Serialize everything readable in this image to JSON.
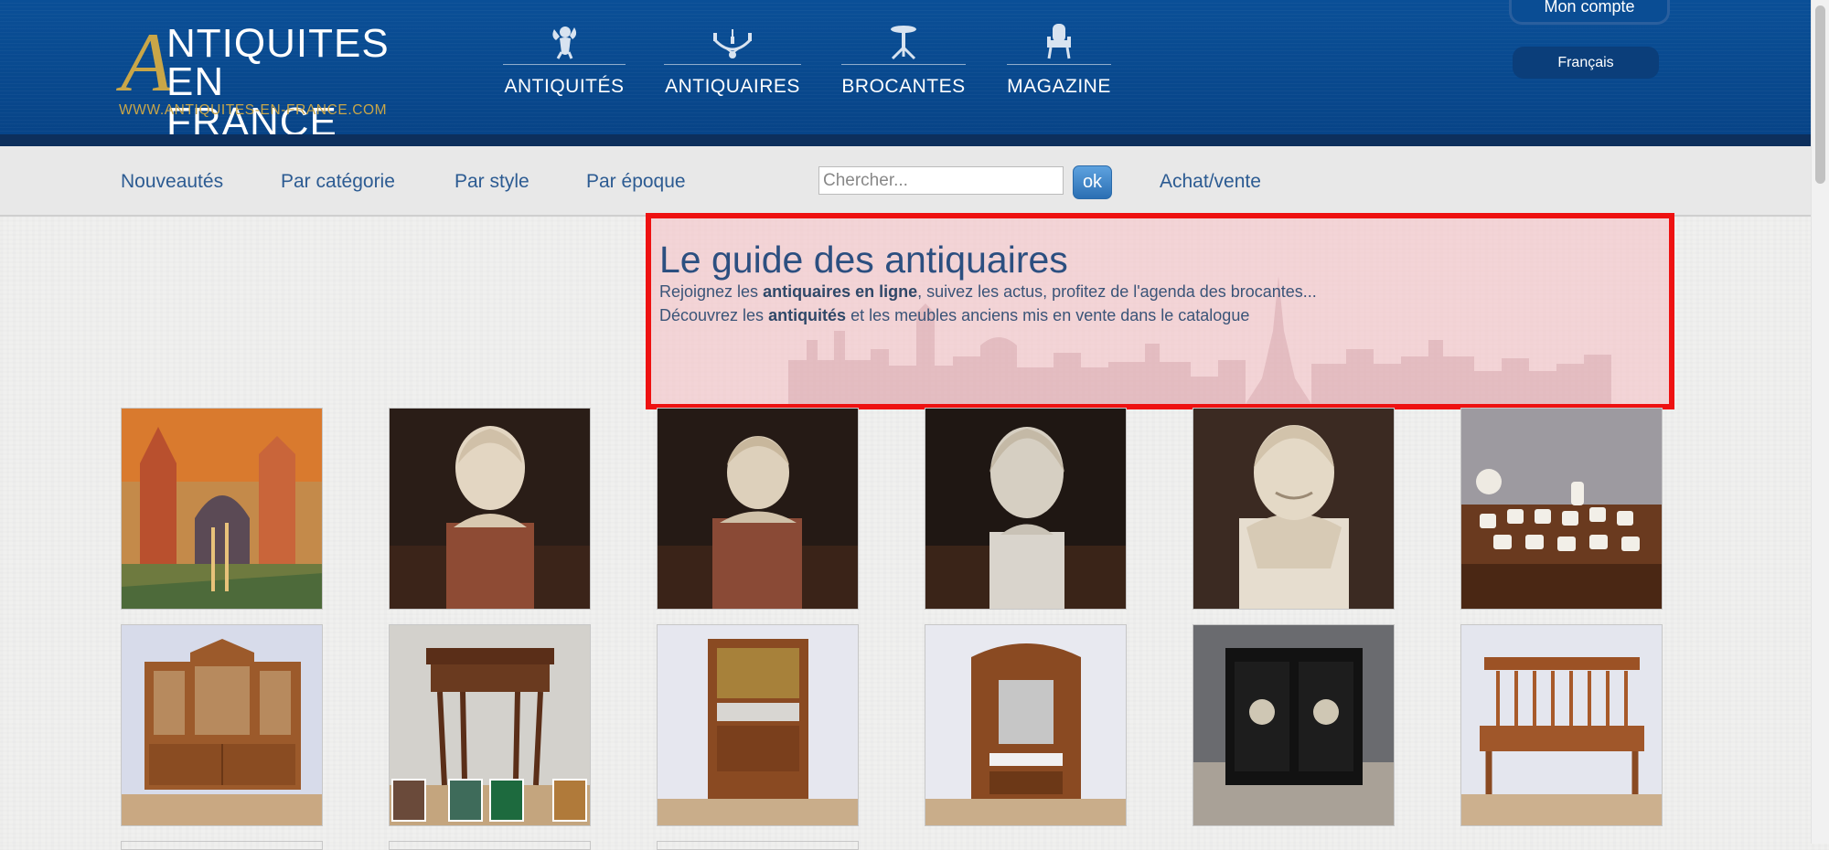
{
  "logo": {
    "line1": "NTIQUITES",
    "line2": "EN FRANCE",
    "letter": "A",
    "url": "WWW.ANTIQUITES-EN-FRANCE.COM"
  },
  "main_nav": [
    {
      "label": "ANTIQUITÉS",
      "icon": "cherub-icon"
    },
    {
      "label": "ANTIQUAIRES",
      "icon": "chandelier-icon"
    },
    {
      "label": "BROCANTES",
      "icon": "pedestal-table-icon"
    },
    {
      "label": "MAGAZINE",
      "icon": "armchair-icon"
    }
  ],
  "account": {
    "label": "Mon compte"
  },
  "language": {
    "label": "Français"
  },
  "sub_nav": {
    "items": [
      "Nouveautés",
      "Par catégorie",
      "Par style",
      "Par époque"
    ],
    "search_placeholder": "Chercher...",
    "ok_label": "ok",
    "buy_sell": "Achat/vente"
  },
  "hero": {
    "title": "Le guide des antiquaires",
    "line1_before": "Rejoignez les ",
    "line1_bold": "antiquaires en ligne",
    "line1_after": ", suivez les actus, profitez de l'agenda des brocantes...",
    "line2_before": "Découvrez les ",
    "line2_bold": "antiquités",
    "line2_after": " et les meubles anciens mis en vente dans le catalogue"
  },
  "colors": {
    "header_blue": "#0a4d94",
    "gold": "#c9a648",
    "link_blue": "#2c5b92",
    "highlight_red": "#ee1111"
  },
  "products": [
    {
      "kind": "painting-ruins"
    },
    {
      "kind": "bust-child"
    },
    {
      "kind": "bust-child-2"
    },
    {
      "kind": "bust-woman"
    },
    {
      "kind": "bust-smiling"
    },
    {
      "kind": "porcelain-tea-set"
    },
    {
      "kind": "bookcase-cabinet"
    },
    {
      "kind": "games-table"
    },
    {
      "kind": "buffet-cabinet"
    },
    {
      "kind": "hall-stand"
    },
    {
      "kind": "black-cabinet"
    },
    {
      "kind": "wooden-bench"
    }
  ]
}
